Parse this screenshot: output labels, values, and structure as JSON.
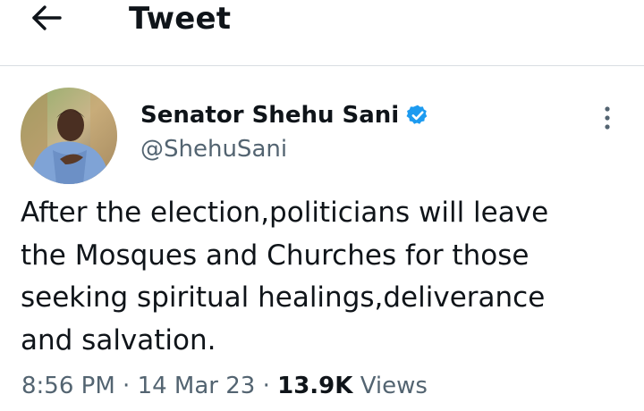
{
  "header": {
    "title": "Tweet",
    "back_icon": "arrow-left-icon"
  },
  "author": {
    "name": "Senator Shehu Sani",
    "handle": "@ShehuSani",
    "verified": true,
    "verified_color": "#1d9bf0"
  },
  "tweet": {
    "text": "After the election,politicians will leave\nthe Mosques and Churches for those\nseeking spiritual healings,deliverance\nand salvation.",
    "time": "8:56 PM",
    "separator": "·",
    "date": "14 Mar 23",
    "views_count": "13.9K",
    "views_label": "Views"
  },
  "colors": {
    "text_primary": "#0f1419",
    "text_secondary": "#536471",
    "divider": "#d9dee2"
  }
}
